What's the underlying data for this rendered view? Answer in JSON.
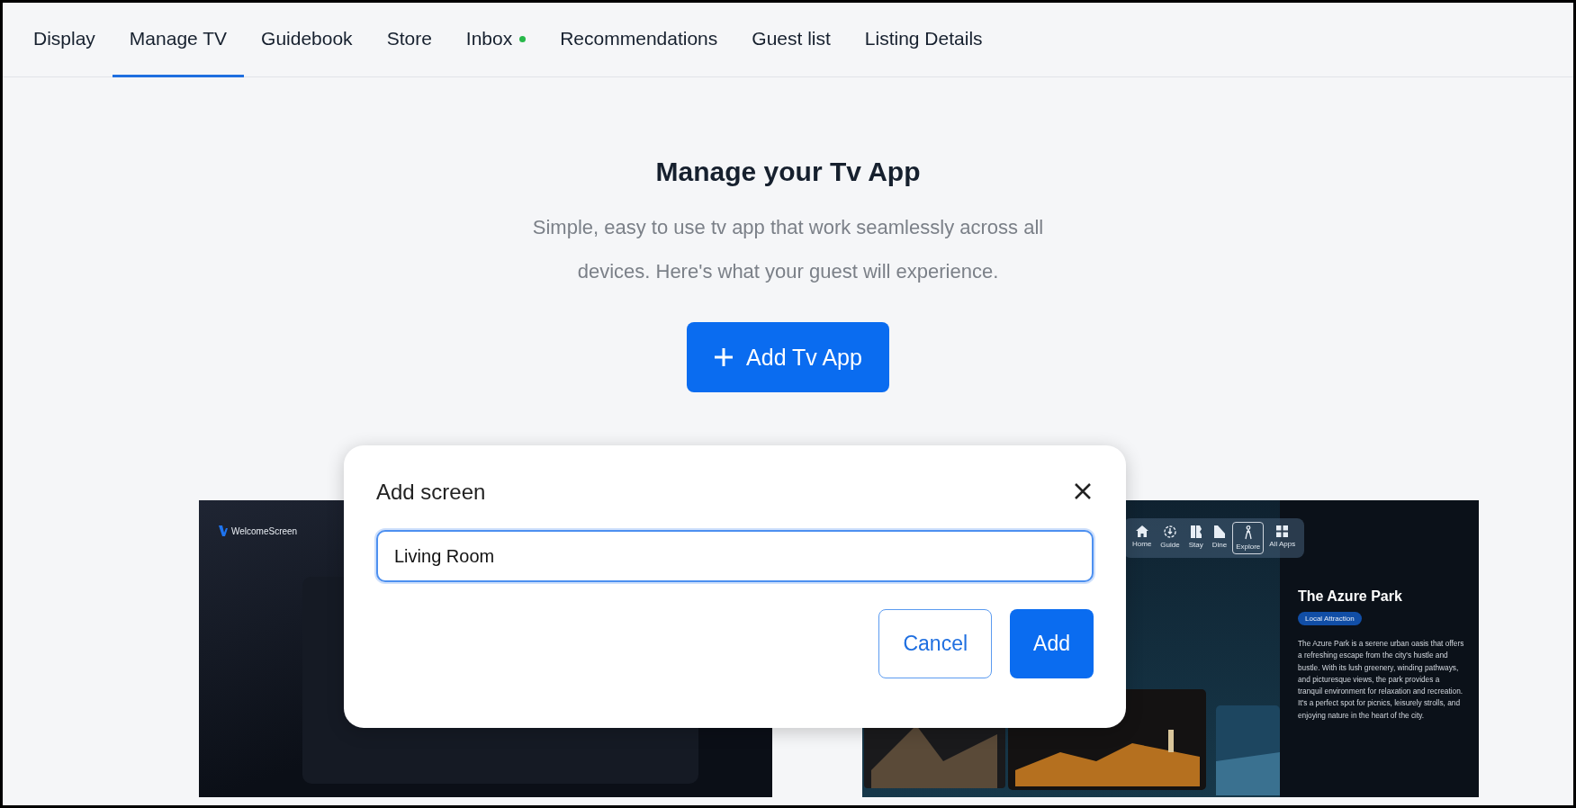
{
  "tabs": [
    {
      "label": "Display",
      "selected": false,
      "unread": false
    },
    {
      "label": "Manage TV",
      "selected": true,
      "unread": false
    },
    {
      "label": "Guidebook",
      "selected": false,
      "unread": false
    },
    {
      "label": "Store",
      "selected": false,
      "unread": false
    },
    {
      "label": "Inbox",
      "selected": false,
      "unread": true
    },
    {
      "label": "Recommendations",
      "selected": false,
      "unread": false
    },
    {
      "label": "Guest list",
      "selected": false,
      "unread": false
    },
    {
      "label": "Listing Details",
      "selected": false,
      "unread": false
    }
  ],
  "hero": {
    "title": "Manage your Tv App",
    "subtitle": "Simple, easy to use tv app that work seamlessly across all devices. Here's what your guest will experience.",
    "button": "Add Tv App"
  },
  "previews": [
    {
      "kind": "welcome",
      "brand": "WelcomeScreen"
    },
    {
      "kind": "explore",
      "nav": [
        {
          "label": "Home",
          "selected": false
        },
        {
          "label": "Guide",
          "selected": false
        },
        {
          "label": "Stay",
          "selected": false
        },
        {
          "label": "Dine",
          "selected": false
        },
        {
          "label": "Explore",
          "selected": true
        },
        {
          "label": "All Apps",
          "selected": false
        }
      ],
      "title": "The Azure Park",
      "tag": "Local Attraction",
      "description": "The Azure Park is a serene urban oasis that offers a refreshing escape from the city's hustle and bustle. With its lush greenery, winding pathways, and picturesque views, the park provides a tranquil environment for relaxation and recreation. It's a perfect spot for picnics, leisurely strolls, and enjoying nature in the heart of the city."
    }
  ],
  "dialog": {
    "title": "Add screen",
    "value": "Living Room",
    "buttons": [
      {
        "label": "Cancel",
        "kind": "secondary"
      },
      {
        "label": "Add",
        "kind": "primary"
      }
    ]
  }
}
